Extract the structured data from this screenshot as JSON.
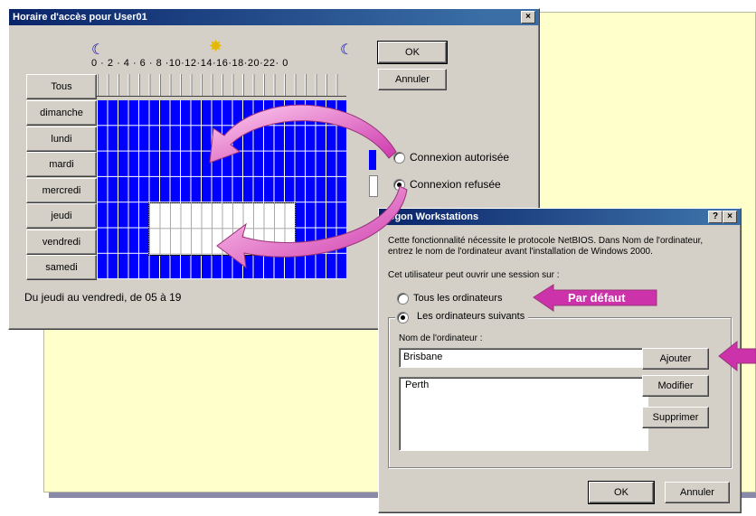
{
  "hours_dialog": {
    "title": "Horaire d'accès pour User01",
    "close": "×",
    "hour_labels": "0 · 2 · 4 · 6 · 8 ·10·12·14·16·18·20·22· 0",
    "all_button": "Tous",
    "days": [
      "dimanche",
      "lundi",
      "mardi",
      "mercredi",
      "jeudi",
      "vendredi",
      "samedi"
    ],
    "ok": "OK",
    "cancel": "Annuler",
    "radio_allowed": "Connexion autorisée",
    "radio_denied": "Connexion refusée",
    "selected_radio": "denied",
    "status": "Du jeudi au vendredi, de 05 à 19"
  },
  "logon_dialog": {
    "title": "Logon Workstations",
    "help": "?",
    "close": "×",
    "description_line1": "Cette fonctionnalité nécessite le protocole NetBIOS. Dans Nom de l'ordinateur,",
    "description_line2": "entrez le nom de l'ordinateur avant l'installation de Windows 2000.",
    "session_label": "Cet utilisateur peut ouvrir une session sur :",
    "radio_all": "Tous les ordinateurs",
    "radio_following": "Les ordinateurs suivants",
    "selected_radio": "following",
    "computer_name_label": "Nom de l'ordinateur :",
    "computer_name_value": "Brisbane",
    "list_items": [
      "Perth"
    ],
    "add": "Ajouter",
    "modify": "Modifier",
    "remove": "Supprimer",
    "ok": "OK",
    "cancel": "Annuler"
  },
  "callout": {
    "default_label": "Par défaut",
    "color": "#cc33aa"
  },
  "colors": {
    "allowed": "#0000ff",
    "denied": "#ffffff",
    "titlebar": "#0a246a",
    "panel": "#ffffcc"
  }
}
